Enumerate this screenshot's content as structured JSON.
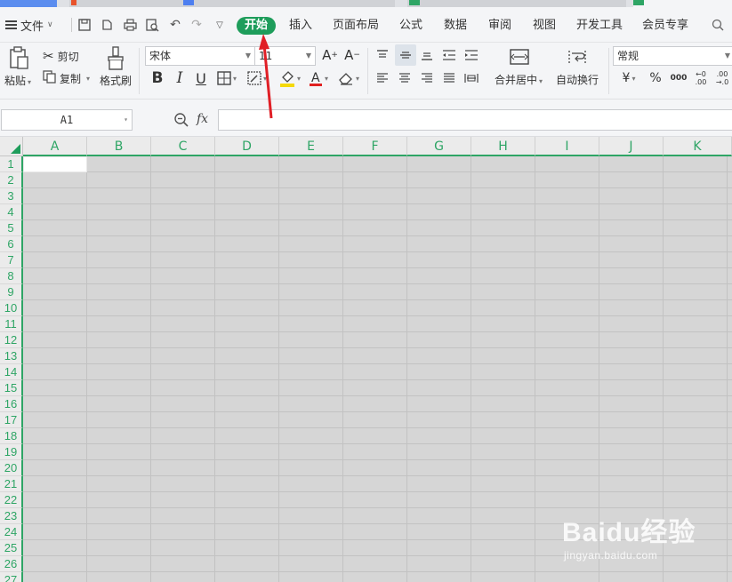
{
  "menubar": {
    "file_label": "文件",
    "tabs": [
      "开始",
      "插入",
      "页面布局",
      "公式",
      "数据",
      "审阅",
      "视图",
      "开发工具",
      "会员专享"
    ],
    "active_tab": "开始",
    "accent_color": "#1e9d5b"
  },
  "ribbon": {
    "paste": "粘贴",
    "cut": "剪切",
    "copy": "复制",
    "format_painter": "格式刷",
    "font_name": "宋体",
    "font_size": "11",
    "merge_center": "合并居中",
    "wrap_text": "自动换行",
    "number_format": "常规",
    "currency_symbol": "¥",
    "percent_symbol": "%",
    "thousands_symbol": "000"
  },
  "formula_bar": {
    "cell_ref": "A1",
    "fx_label": "fx",
    "value": ""
  },
  "sheet": {
    "columns": [
      "A",
      "B",
      "C",
      "D",
      "E",
      "F",
      "G",
      "H",
      "I",
      "J",
      "K"
    ],
    "rows": [
      "1",
      "2",
      "3",
      "4",
      "5",
      "6",
      "7",
      "8",
      "9",
      "10",
      "11",
      "12",
      "13",
      "14",
      "15",
      "16",
      "17",
      "18",
      "19",
      "20",
      "21",
      "22",
      "23",
      "24",
      "25",
      "26",
      "27"
    ],
    "header_color": "#2ea565"
  },
  "watermark": {
    "brand": "Baidu经验",
    "url": "jingyan.baidu.com"
  }
}
